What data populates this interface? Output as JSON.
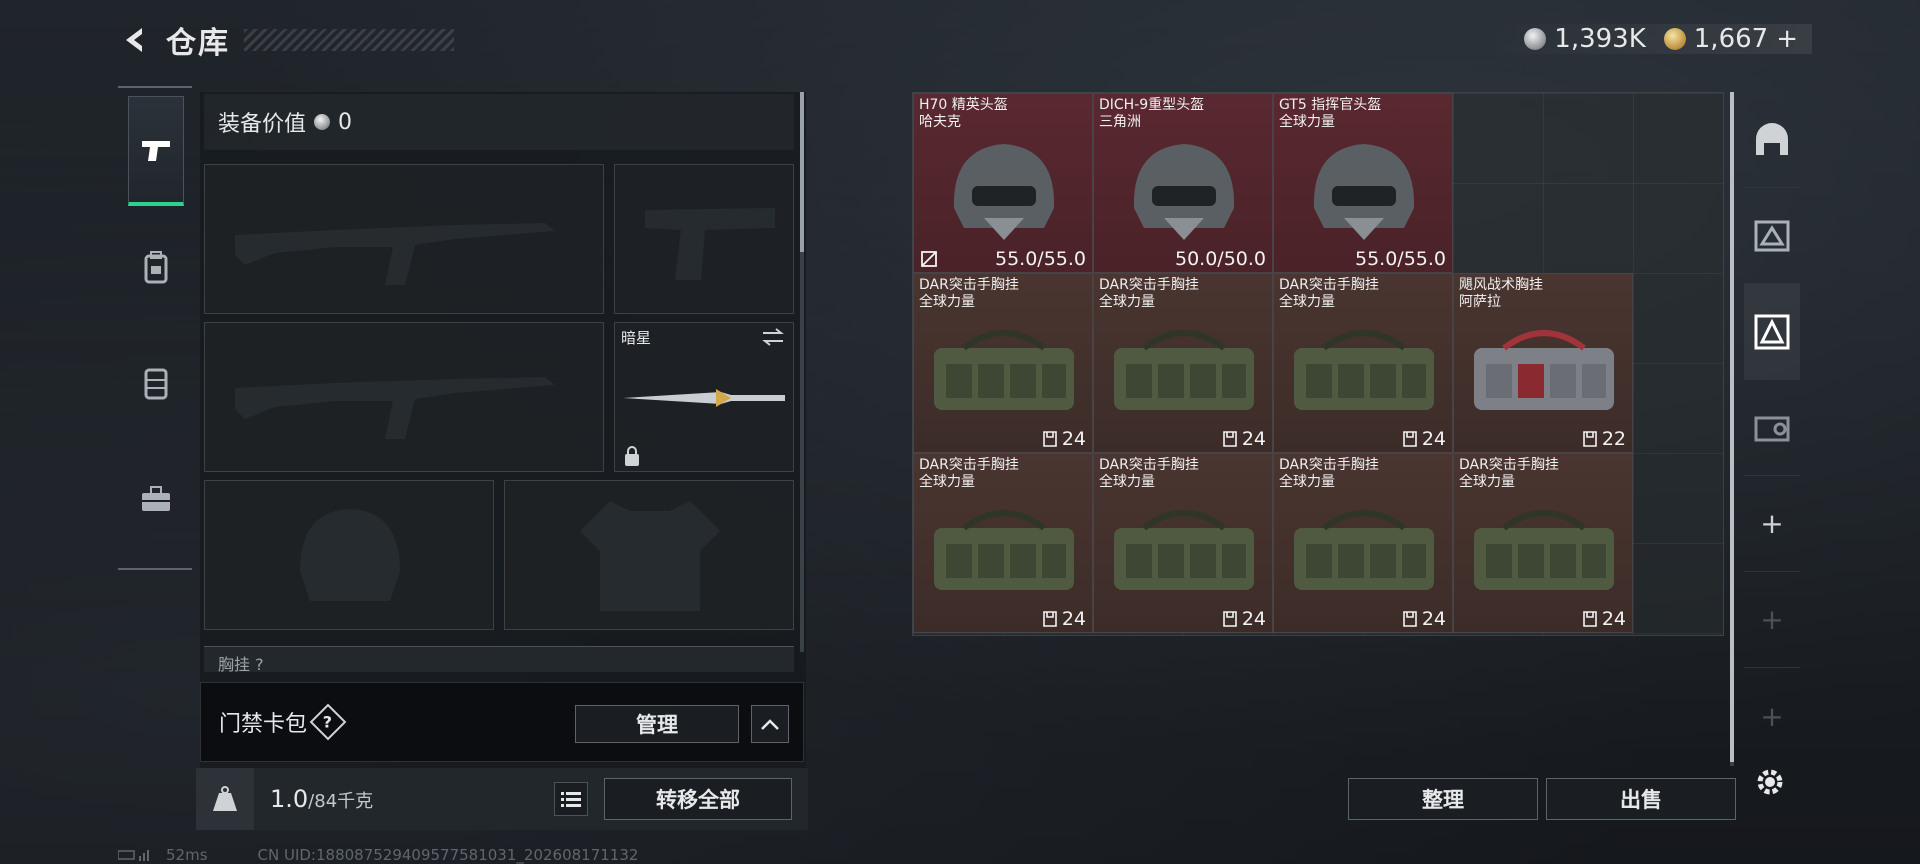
{
  "header": {
    "title": "仓库"
  },
  "currency": {
    "silver": "1,393K",
    "gold": "1,667",
    "gold_plus": "+"
  },
  "left_rail": {
    "tabs": [
      "pistol-icon",
      "backpack-icon",
      "rig-icon",
      "briefcase-icon"
    ]
  },
  "loadout": {
    "equip_value_label": "装备价值",
    "equip_value": "0",
    "melee_label": "暗星",
    "chest_label_partial": "胸挂 ?"
  },
  "keycard": {
    "label": "门禁卡包",
    "help": "?",
    "manage": "管理"
  },
  "weight": {
    "current": "1.0",
    "max": "/84千克",
    "transfer_all": "转移全部"
  },
  "status": {
    "ping": "52ms",
    "uid": "CN UID:1880875294095775810​31_202608171132"
  },
  "stash": {
    "items": [
      {
        "name": "H70 精英头盔",
        "sub": "哈夫克",
        "value": "55.0/55.0",
        "kind": "helmet",
        "marked": true
      },
      {
        "name": "DICH-9重型头盔",
        "sub": "三角洲",
        "value": "50.0/50.0",
        "kind": "helmet"
      },
      {
        "name": "GT5 指挥官头盔",
        "sub": "全球力量",
        "value": "55.0/55.0",
        "kind": "helmet"
      },
      {
        "name": "DAR突击手胸挂",
        "sub": "全球力量",
        "value": "24",
        "kind": "rig"
      },
      {
        "name": "DAR突击手胸挂",
        "sub": "全球力量",
        "value": "24",
        "kind": "rig"
      },
      {
        "name": "DAR突击手胸挂",
        "sub": "全球力量",
        "value": "24",
        "kind": "rig"
      },
      {
        "name": "飓风战术胸挂",
        "sub": "阿萨拉",
        "value": "22",
        "kind": "rig"
      },
      {
        "name": "DAR突击手胸挂",
        "sub": "全球力量",
        "value": "24",
        "kind": "rig"
      },
      {
        "name": "DAR突击手胸挂",
        "sub": "全球力量",
        "value": "24",
        "kind": "rig"
      },
      {
        "name": "DAR突击手胸挂",
        "sub": "全球力量",
        "value": "24",
        "kind": "rig"
      },
      {
        "name": "DAR突击手胸挂",
        "sub": "全球力量",
        "value": "24",
        "kind": "rig"
      }
    ]
  },
  "actions": {
    "sort": "整理",
    "sell": "出售"
  }
}
